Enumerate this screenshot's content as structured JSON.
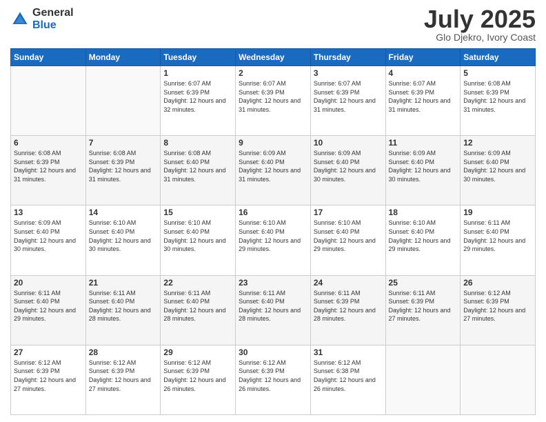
{
  "header": {
    "logo_general": "General",
    "logo_blue": "Blue",
    "title": "July 2025",
    "location": "Glo Djekro, Ivory Coast"
  },
  "days_of_week": [
    "Sunday",
    "Monday",
    "Tuesday",
    "Wednesday",
    "Thursday",
    "Friday",
    "Saturday"
  ],
  "weeks": [
    {
      "days": [
        {
          "num": "",
          "info": ""
        },
        {
          "num": "",
          "info": ""
        },
        {
          "num": "1",
          "info": "Sunrise: 6:07 AM\nSunset: 6:39 PM\nDaylight: 12 hours and 32 minutes."
        },
        {
          "num": "2",
          "info": "Sunrise: 6:07 AM\nSunset: 6:39 PM\nDaylight: 12 hours and 31 minutes."
        },
        {
          "num": "3",
          "info": "Sunrise: 6:07 AM\nSunset: 6:39 PM\nDaylight: 12 hours and 31 minutes."
        },
        {
          "num": "4",
          "info": "Sunrise: 6:07 AM\nSunset: 6:39 PM\nDaylight: 12 hours and 31 minutes."
        },
        {
          "num": "5",
          "info": "Sunrise: 6:08 AM\nSunset: 6:39 PM\nDaylight: 12 hours and 31 minutes."
        }
      ]
    },
    {
      "days": [
        {
          "num": "6",
          "info": "Sunrise: 6:08 AM\nSunset: 6:39 PM\nDaylight: 12 hours and 31 minutes."
        },
        {
          "num": "7",
          "info": "Sunrise: 6:08 AM\nSunset: 6:39 PM\nDaylight: 12 hours and 31 minutes."
        },
        {
          "num": "8",
          "info": "Sunrise: 6:08 AM\nSunset: 6:40 PM\nDaylight: 12 hours and 31 minutes."
        },
        {
          "num": "9",
          "info": "Sunrise: 6:09 AM\nSunset: 6:40 PM\nDaylight: 12 hours and 31 minutes."
        },
        {
          "num": "10",
          "info": "Sunrise: 6:09 AM\nSunset: 6:40 PM\nDaylight: 12 hours and 30 minutes."
        },
        {
          "num": "11",
          "info": "Sunrise: 6:09 AM\nSunset: 6:40 PM\nDaylight: 12 hours and 30 minutes."
        },
        {
          "num": "12",
          "info": "Sunrise: 6:09 AM\nSunset: 6:40 PM\nDaylight: 12 hours and 30 minutes."
        }
      ]
    },
    {
      "days": [
        {
          "num": "13",
          "info": "Sunrise: 6:09 AM\nSunset: 6:40 PM\nDaylight: 12 hours and 30 minutes."
        },
        {
          "num": "14",
          "info": "Sunrise: 6:10 AM\nSunset: 6:40 PM\nDaylight: 12 hours and 30 minutes."
        },
        {
          "num": "15",
          "info": "Sunrise: 6:10 AM\nSunset: 6:40 PM\nDaylight: 12 hours and 30 minutes."
        },
        {
          "num": "16",
          "info": "Sunrise: 6:10 AM\nSunset: 6:40 PM\nDaylight: 12 hours and 29 minutes."
        },
        {
          "num": "17",
          "info": "Sunrise: 6:10 AM\nSunset: 6:40 PM\nDaylight: 12 hours and 29 minutes."
        },
        {
          "num": "18",
          "info": "Sunrise: 6:10 AM\nSunset: 6:40 PM\nDaylight: 12 hours and 29 minutes."
        },
        {
          "num": "19",
          "info": "Sunrise: 6:11 AM\nSunset: 6:40 PM\nDaylight: 12 hours and 29 minutes."
        }
      ]
    },
    {
      "days": [
        {
          "num": "20",
          "info": "Sunrise: 6:11 AM\nSunset: 6:40 PM\nDaylight: 12 hours and 29 minutes."
        },
        {
          "num": "21",
          "info": "Sunrise: 6:11 AM\nSunset: 6:40 PM\nDaylight: 12 hours and 28 minutes."
        },
        {
          "num": "22",
          "info": "Sunrise: 6:11 AM\nSunset: 6:40 PM\nDaylight: 12 hours and 28 minutes."
        },
        {
          "num": "23",
          "info": "Sunrise: 6:11 AM\nSunset: 6:40 PM\nDaylight: 12 hours and 28 minutes."
        },
        {
          "num": "24",
          "info": "Sunrise: 6:11 AM\nSunset: 6:39 PM\nDaylight: 12 hours and 28 minutes."
        },
        {
          "num": "25",
          "info": "Sunrise: 6:11 AM\nSunset: 6:39 PM\nDaylight: 12 hours and 27 minutes."
        },
        {
          "num": "26",
          "info": "Sunrise: 6:12 AM\nSunset: 6:39 PM\nDaylight: 12 hours and 27 minutes."
        }
      ]
    },
    {
      "days": [
        {
          "num": "27",
          "info": "Sunrise: 6:12 AM\nSunset: 6:39 PM\nDaylight: 12 hours and 27 minutes."
        },
        {
          "num": "28",
          "info": "Sunrise: 6:12 AM\nSunset: 6:39 PM\nDaylight: 12 hours and 27 minutes."
        },
        {
          "num": "29",
          "info": "Sunrise: 6:12 AM\nSunset: 6:39 PM\nDaylight: 12 hours and 26 minutes."
        },
        {
          "num": "30",
          "info": "Sunrise: 6:12 AM\nSunset: 6:39 PM\nDaylight: 12 hours and 26 minutes."
        },
        {
          "num": "31",
          "info": "Sunrise: 6:12 AM\nSunset: 6:38 PM\nDaylight: 12 hours and 26 minutes."
        },
        {
          "num": "",
          "info": ""
        },
        {
          "num": "",
          "info": ""
        }
      ]
    }
  ]
}
